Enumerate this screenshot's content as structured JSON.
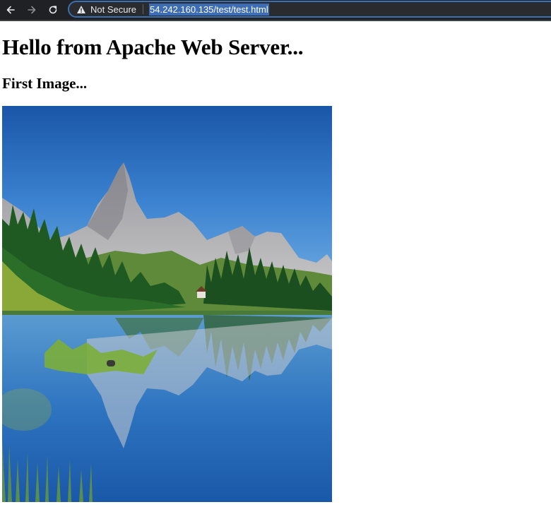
{
  "browser": {
    "security_label": "Not Secure",
    "url": "54.242.160.135/test/test.html",
    "accent_color": "#3d6db5"
  },
  "page": {
    "heading": "Hello from Apache Web Server...",
    "subheading": "First Image...",
    "image": {
      "subject": "mountain lake landscape with pine forest and reflection"
    }
  }
}
